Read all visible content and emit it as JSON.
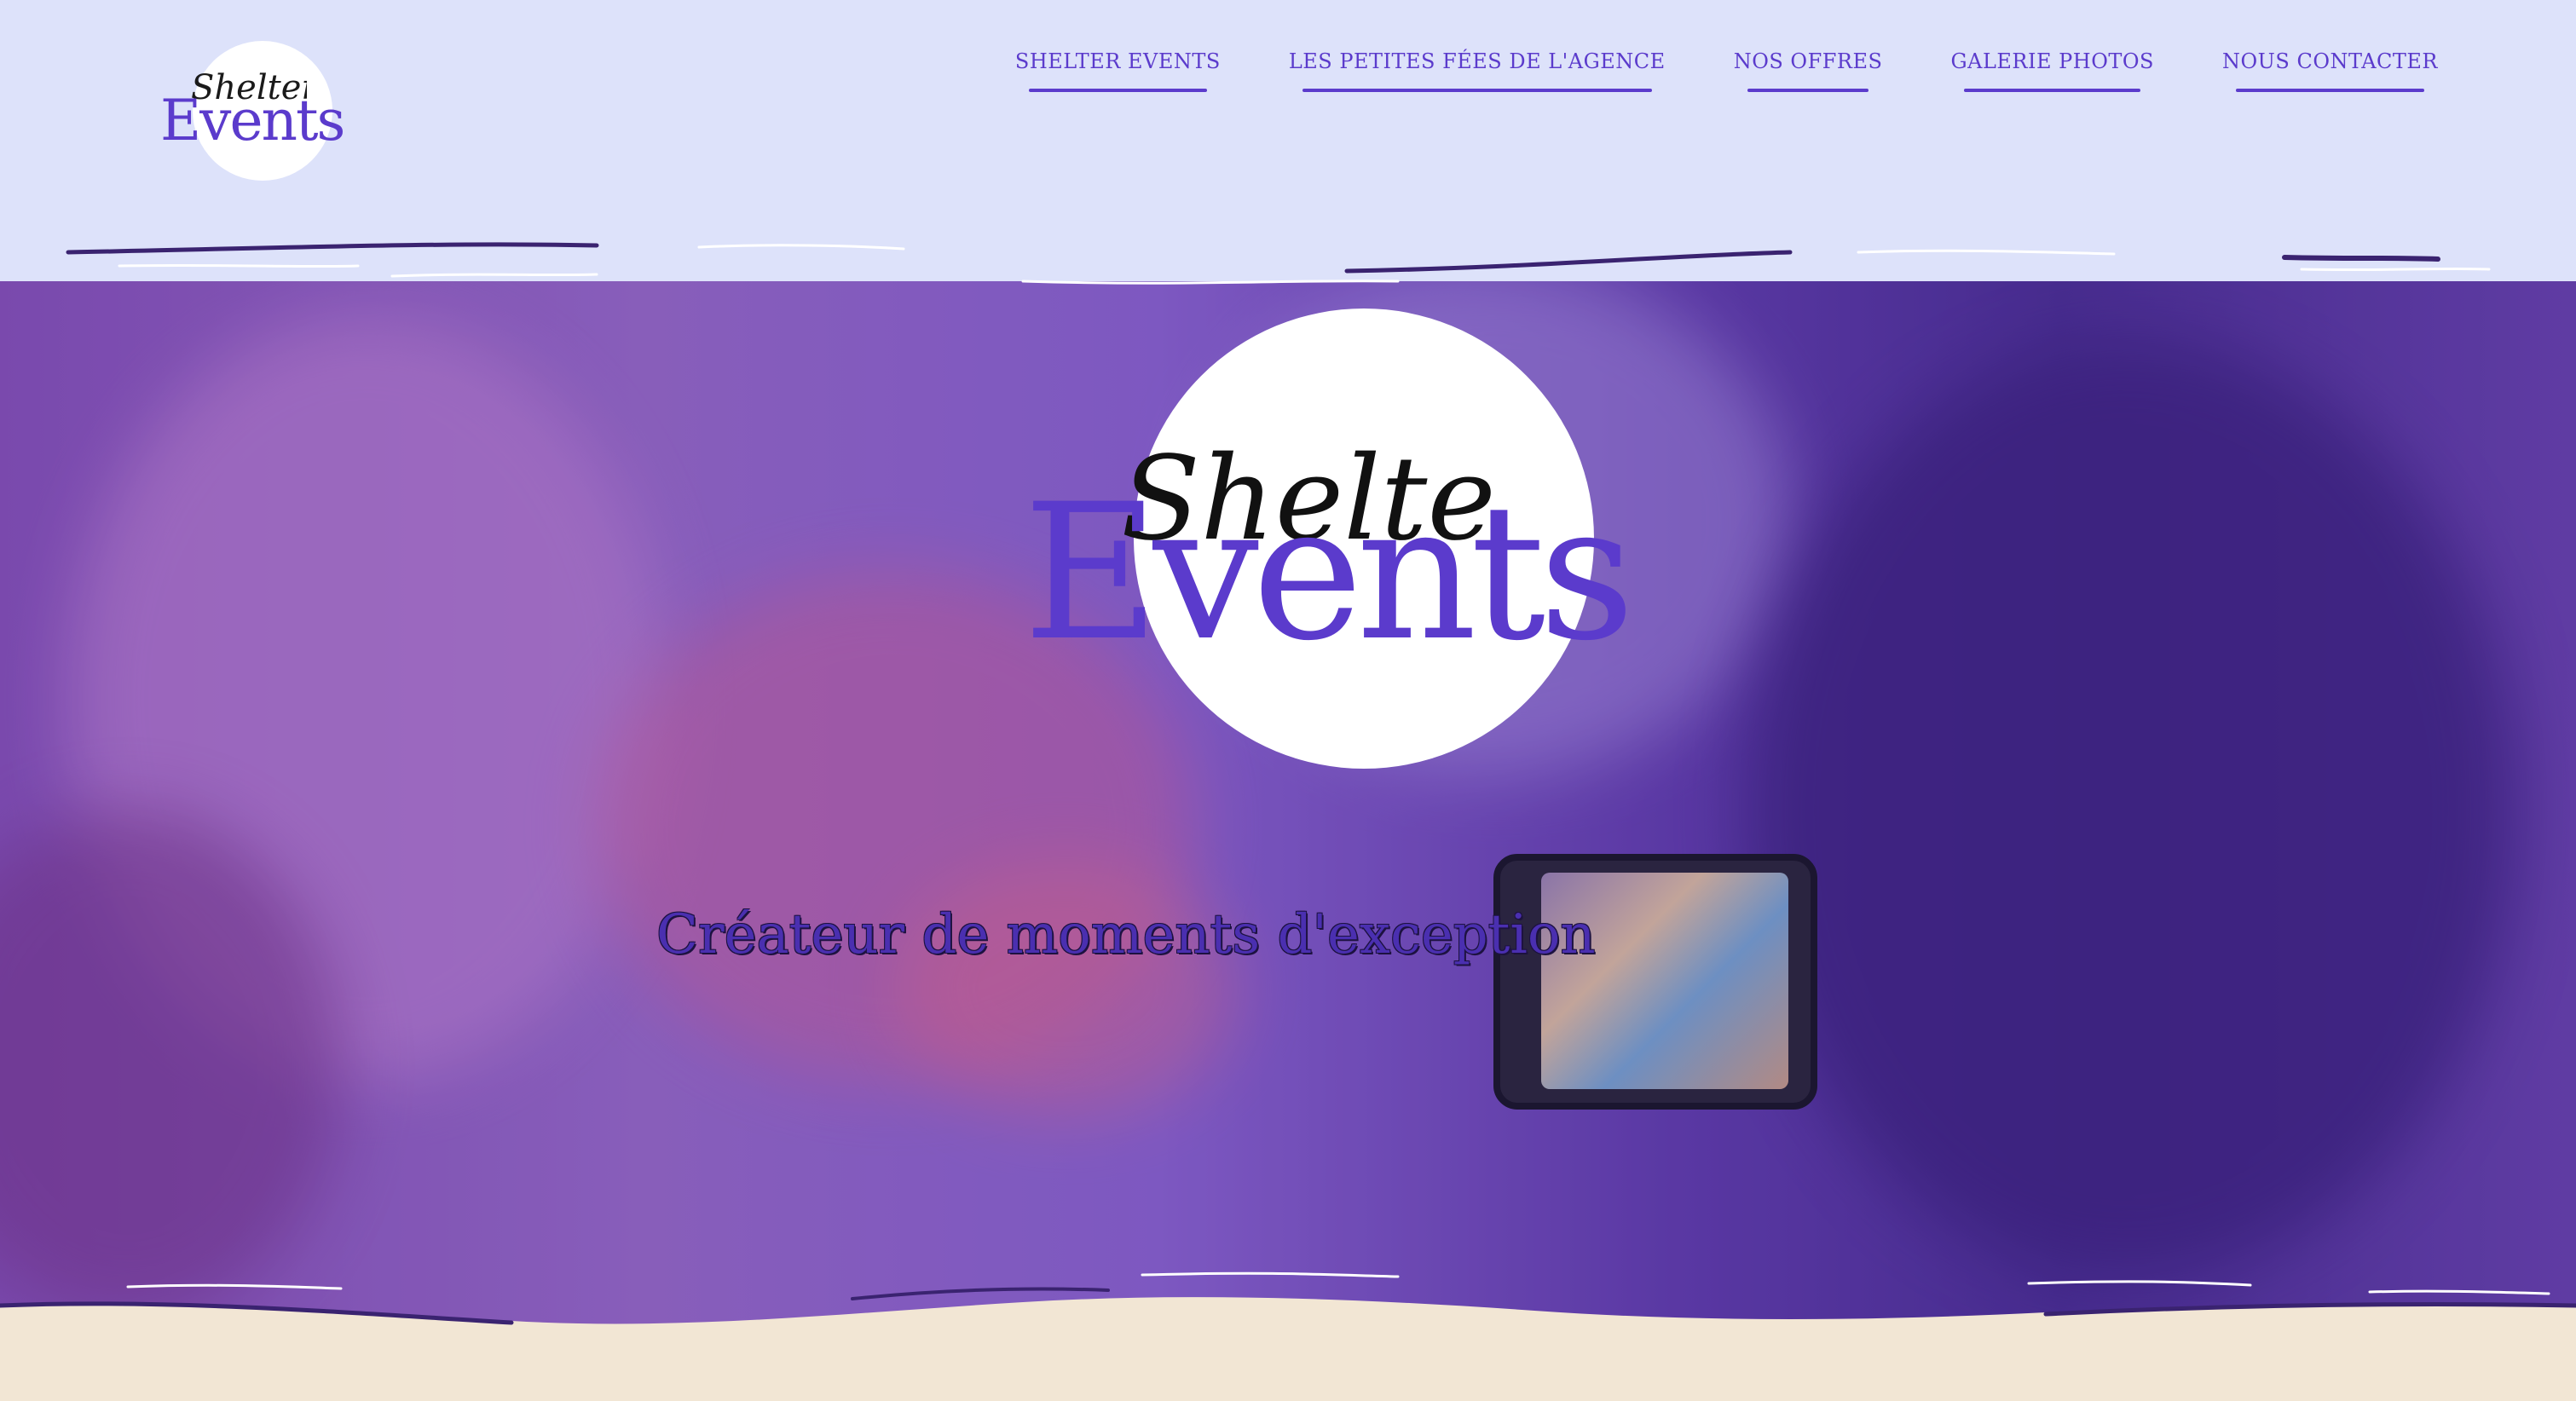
{
  "brand": {
    "script_word": "Shelter",
    "main_word": "Events"
  },
  "nav": {
    "items": [
      {
        "label": "SHELTER EVENTS"
      },
      {
        "label": "LES PETITES FÉES DE L'AGENCE"
      },
      {
        "label": "NOS OFFRES"
      },
      {
        "label": "GALERIE PHOTOS"
      },
      {
        "label": "NOUS CONTACTER"
      }
    ]
  },
  "hero": {
    "tagline": "Créateur de moments d'exception"
  },
  "colors": {
    "header_bg": "#dde2fa",
    "accent_purple": "#5b3bcc",
    "footer_bg": "#f2e6d4",
    "hero_dark": "#3c2682"
  },
  "icons": {
    "logo": "shelter-events-logo"
  }
}
